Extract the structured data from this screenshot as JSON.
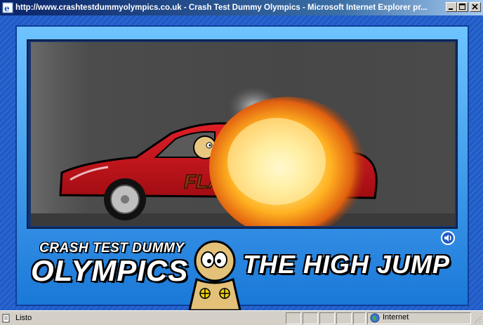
{
  "window": {
    "title": "http://www.crashtestdummyolympics.co.uk - Crash Test Dummy Olympics - Microsoft Internet Explorer pr...",
    "icon": "ie-icon",
    "controls": [
      "minimize-icon",
      "maximize-icon",
      "close-icon"
    ]
  },
  "game": {
    "logo_line1": "CRASH TEST DUMMY",
    "logo_line2": "OLYMPICS",
    "event_title": "THE HIGH JUMP",
    "car_decal": "FLASHOUT",
    "sound_icon": "speaker-icon",
    "colors": {
      "car": "#c8141a",
      "frame": "#1f5cc8",
      "banner_text": "#ffffff"
    }
  },
  "statusbar": {
    "status_text": "Listo",
    "zone_text": "Internet",
    "zone_icon": "globe-icon"
  }
}
